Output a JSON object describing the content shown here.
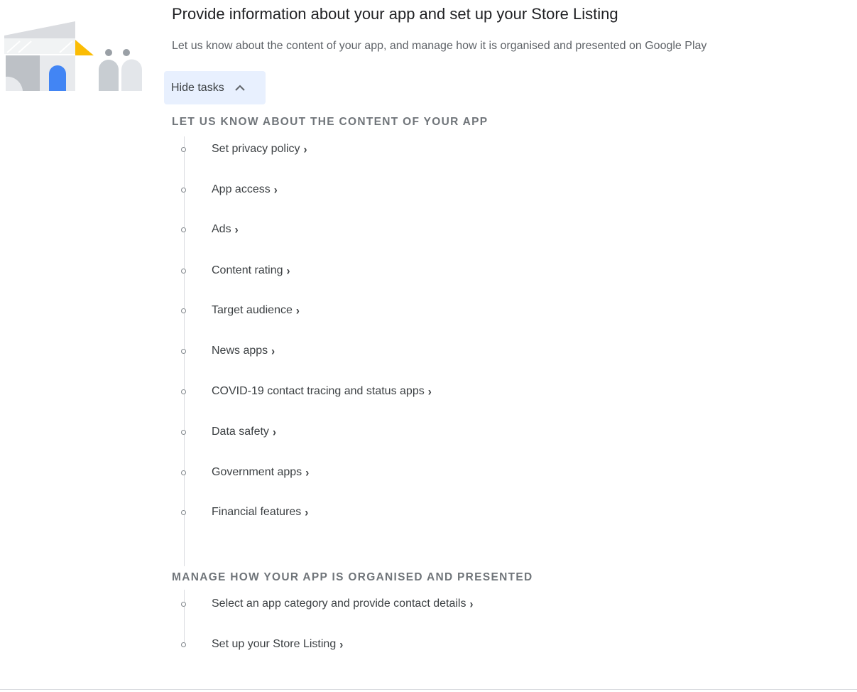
{
  "header": {
    "title": "Provide information about your app and set up your Store Listing",
    "subtitle": "Let us know about the content of your app, and manage how it is organised and presented on Google Play",
    "hide_tasks_label": "Hide tasks",
    "hide_tasks_icon": "chevron-up-icon"
  },
  "sections": [
    {
      "heading": "LET US KNOW ABOUT THE CONTENT OF YOUR APP",
      "tasks": [
        {
          "label": "Set privacy policy"
        },
        {
          "label": "App access"
        },
        {
          "label": "Ads"
        },
        {
          "label": "Content rating"
        },
        {
          "label": "Target audience"
        },
        {
          "label": "News apps"
        },
        {
          "label": "COVID-19 contact tracing and status apps"
        },
        {
          "label": "Data safety"
        },
        {
          "label": "Government apps"
        },
        {
          "label": "Financial features"
        }
      ]
    },
    {
      "heading": "MANAGE HOW YOUR APP IS ORGANISED AND PRESENTED",
      "tasks": [
        {
          "label": "Select an app category and provide contact details"
        },
        {
          "label": "Set up your Store Listing"
        }
      ]
    }
  ],
  "task_arrow": "›",
  "colors": {
    "accent_blue": "#4285f4",
    "accent_yellow": "#fbbc04",
    "button_bg": "#e8f0fe",
    "heading_gray": "#70757a"
  }
}
